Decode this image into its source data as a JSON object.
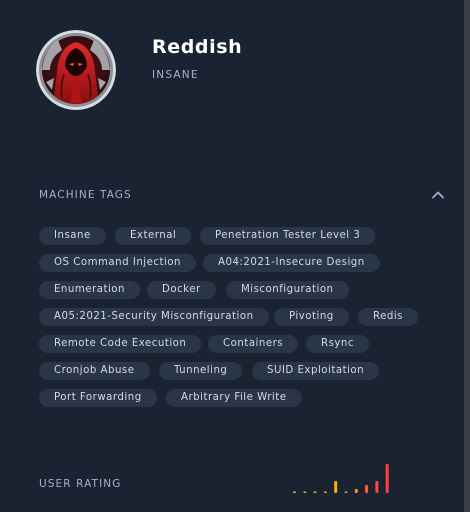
{
  "machine": {
    "name": "Reddish",
    "difficulty": "INSANE"
  },
  "tags_section": {
    "title": "MACHINE TAGS",
    "tags": [
      "Insane",
      "External",
      "Penetration Tester Level 3",
      "OS Command Injection",
      "A04:2021-Insecure Design",
      "Enumeration",
      "Docker",
      "Misconfiguration",
      "A05:2021-Security Misconfiguration",
      "Pivoting",
      "Redis",
      "Remote Code Execution",
      "Containers",
      "Rsync",
      "Cronjob Abuse",
      "Tunneling",
      "SUID Exploitation",
      "Port Forwarding",
      "Arbitrary File Write"
    ]
  },
  "rating_section": {
    "title": "USER RATING",
    "bars": [
      {
        "value": 1,
        "color": "#9fef00"
      },
      {
        "value": 1,
        "color": "#c7d600"
      },
      {
        "value": 1,
        "color": "#dfd000"
      },
      {
        "value": 1,
        "color": "#f0c000"
      },
      {
        "value": 12,
        "color": "#ffaf00"
      },
      {
        "value": 1,
        "color": "#ff9a1f"
      },
      {
        "value": 4,
        "color": "#ff8a28"
      },
      {
        "value": 8,
        "color": "#ff5f2e"
      },
      {
        "value": 12,
        "color": "#ff4a3a"
      },
      {
        "value": 29,
        "color": "#ff3e3e"
      }
    ]
  },
  "colors": {
    "background": "#1a2332",
    "tag_background": "#2a3546",
    "muted_text": "#a4b1cd"
  }
}
